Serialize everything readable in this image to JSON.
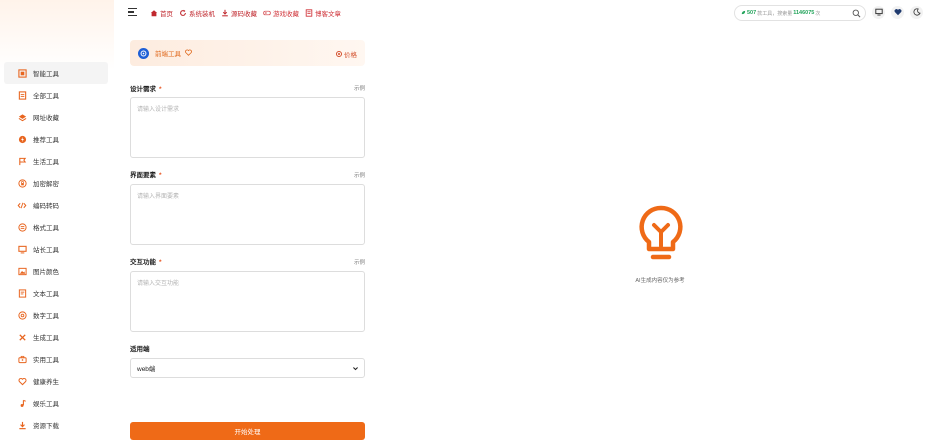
{
  "colors": {
    "accent": "#ef6a17",
    "nav_red": "#c0282e",
    "sidebar_icon": "#e8651f",
    "green": "#21a35a"
  },
  "sidebar": {
    "items": [
      {
        "label": "智能工具",
        "icon": "grid-box-icon",
        "active": true
      },
      {
        "label": "全部工具",
        "icon": "document-list-icon"
      },
      {
        "label": "网址收藏",
        "icon": "layers-icon"
      },
      {
        "label": "推荐工具",
        "icon": "bolt-circle-icon"
      },
      {
        "label": "生活工具",
        "icon": "flag-icon"
      },
      {
        "label": "加密解密",
        "icon": "lock-circle-icon"
      },
      {
        "label": "编码转码",
        "icon": "code-icon"
      },
      {
        "label": "格式工具",
        "icon": "format-circle-icon"
      },
      {
        "label": "站长工具",
        "icon": "monitor-icon"
      },
      {
        "label": "图片颜色",
        "icon": "image-icon"
      },
      {
        "label": "文本工具",
        "icon": "text-doc-icon"
      },
      {
        "label": "数字工具",
        "icon": "at-sign-icon"
      },
      {
        "label": "生成工具",
        "icon": "tools-icon"
      },
      {
        "label": "实用工具",
        "icon": "toolbox-icon"
      },
      {
        "label": "健康养生",
        "icon": "heart-outline-icon"
      },
      {
        "label": "娱乐工具",
        "icon": "music-note-icon"
      },
      {
        "label": "资源下载",
        "icon": "download-icon"
      }
    ]
  },
  "topbar": {
    "nav": [
      {
        "label": "首页",
        "icon": "home-icon"
      },
      {
        "label": "系统装机",
        "icon": "refresh-icon"
      },
      {
        "label": "源码收藏",
        "icon": "download-icon"
      },
      {
        "label": "游戏收藏",
        "icon": "gamepad-icon"
      },
      {
        "label": "博客文章",
        "icon": "article-icon"
      }
    ],
    "search": {
      "count_tools": "507",
      "tools_text": "款工具，搜索量",
      "count_searches": "1146075",
      "suffix": "次"
    }
  },
  "form": {
    "tool_name": "前端工具",
    "price_label": "价格",
    "fields": [
      {
        "label": "设计需求",
        "required_mark": "*",
        "example": "示例",
        "placeholder": "请输入设计需求"
      },
      {
        "label": "界面要素",
        "required_mark": "*",
        "example": "示例",
        "placeholder": "请输入界面要素"
      },
      {
        "label": "交互功能",
        "required_mark": "*",
        "example": "示例",
        "placeholder": "请输入交互功能"
      }
    ],
    "platform_label": "适用端",
    "platform_value": "web端",
    "submit_label": "开始处理"
  },
  "result": {
    "icon": "lightbulb-icon",
    "text": "AI生成内容仅为参考"
  }
}
